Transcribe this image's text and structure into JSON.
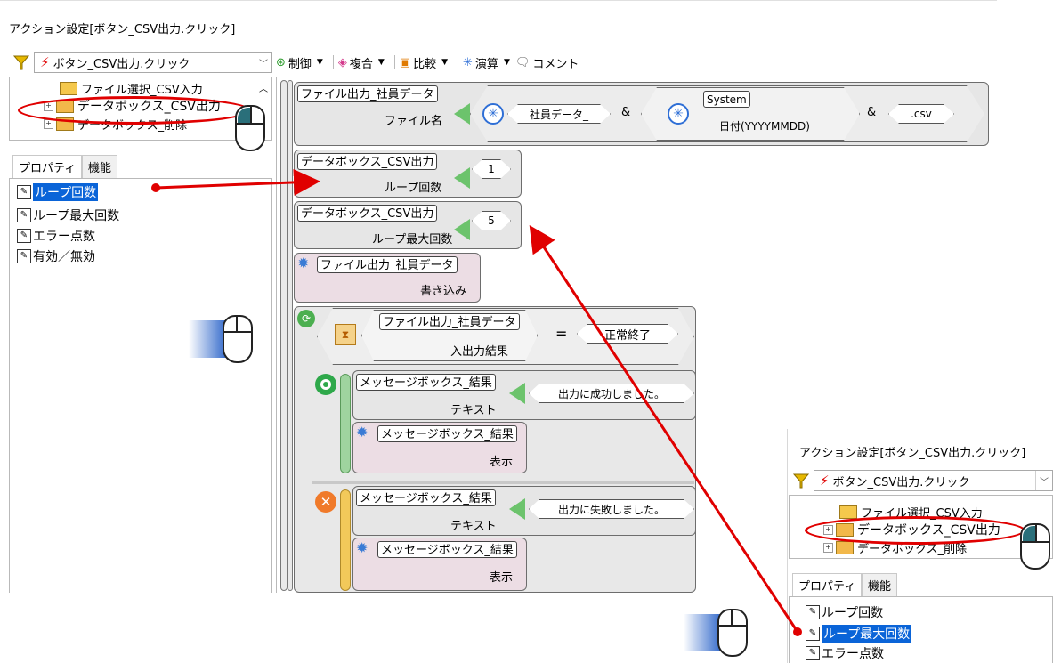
{
  "window": {
    "title": "アクション設定[ボタン_CSV出力.クリック]"
  },
  "event_select": {
    "value": "ボタン_CSV出力.クリック"
  },
  "tree": {
    "items": [
      {
        "label": "ファイル選択_CSV入力"
      },
      {
        "label": "データボックス_CSV出力"
      },
      {
        "label": "データボックス_削除"
      }
    ]
  },
  "tabs": {
    "properties": "プロパティ",
    "functions": "機能"
  },
  "properties": [
    {
      "label": "ループ回数"
    },
    {
      "label": "ループ最大回数"
    },
    {
      "label": "エラー点数"
    },
    {
      "label": "有効／無効"
    }
  ],
  "toolbar": {
    "control": "制御",
    "composite": "複合",
    "compare": "比較",
    "calc": "演算",
    "comment": "コメント"
  },
  "flow": {
    "b1": {
      "target": "ファイル出力_社員データ",
      "prop": "ファイル名",
      "str1": "社員データ_",
      "amp1": "&",
      "system": "System",
      "date": "日付(YYYYMMDD)",
      "amp2": "&",
      "ext": ".csv"
    },
    "b2": {
      "target": "データボックス_CSV出力",
      "prop": "ループ回数",
      "value": "1"
    },
    "b3": {
      "target": "データボックス_CSV出力",
      "prop": "ループ最大回数",
      "value": "5"
    },
    "b4": {
      "target": "ファイル出力_社員データ",
      "prop": "書き込み"
    },
    "cond": {
      "target": "ファイル出力_社員データ",
      "prop": "入出力結果",
      "eq": "=",
      "value": "正常終了"
    },
    "ok1": {
      "target": "メッセージボックス_結果",
      "prop": "テキスト",
      "value": "出力に成功しました。"
    },
    "ok2": {
      "target": "メッセージボックス_結果",
      "prop": "表示"
    },
    "ng1": {
      "target": "メッセージボックス_結果",
      "prop": "テキスト",
      "value": "出力に失敗しました。"
    },
    "ng2": {
      "target": "メッセージボックス_結果",
      "prop": "表示"
    }
  },
  "inset": {
    "title": "アクション設定[ボタン_CSV出力.クリック]",
    "event_select": "ボタン_CSV出力.クリック",
    "tree": [
      "ファイル選択_CSV入力",
      "データボックス_CSV出力",
      "データボックス_削除"
    ],
    "tabs": {
      "properties": "プロパティ",
      "functions": "機能"
    },
    "properties": [
      "ループ回数",
      "ループ最大回数",
      "エラー点数"
    ]
  },
  "colors": {
    "selection": "#0a64d8",
    "arrow": "#e00000",
    "ellipse": "#e00000",
    "green": "#6cc36c"
  }
}
